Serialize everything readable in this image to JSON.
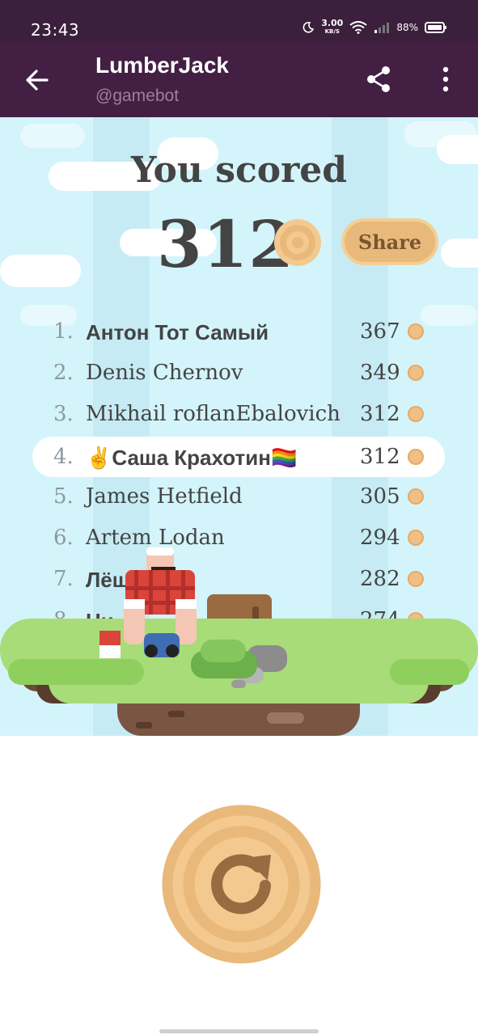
{
  "status_bar": {
    "time": "23:43",
    "speed_value": "3.00",
    "speed_unit": "KB/S",
    "battery": "88%"
  },
  "app_bar": {
    "title": "LumberJack",
    "subtitle": "@gamebot"
  },
  "game": {
    "heading": "You scored",
    "score": "312",
    "share_label": "Share",
    "leaderboard": [
      {
        "rank": "1.",
        "name": "Антон Тот Самый",
        "score": "367"
      },
      {
        "rank": "2.",
        "name": "Denis Chernov",
        "score": "349"
      },
      {
        "rank": "3.",
        "name": "Mikhail roflanEbalovich",
        "score": "312"
      },
      {
        "rank": "4.",
        "name": "✌️Саша Крахотин🏳️‍🌈",
        "score": "312"
      },
      {
        "rank": "5.",
        "name": "James Hetfield",
        "score": "305"
      },
      {
        "rank": "6.",
        "name": "Artem Lodan",
        "score": "294"
      },
      {
        "rank": "7.",
        "name": "Лёш",
        "score": "282"
      },
      {
        "rank": "8.",
        "name": "Ни",
        "score": "274"
      }
    ]
  },
  "icons": {
    "back": "arrow-left-icon",
    "share": "share-icon",
    "more": "more-vertical-icon",
    "replay": "replay-icon"
  },
  "colors": {
    "status_bar": "#3b1f3c",
    "app_bar": "#431f44",
    "sky": "#d3f4fa",
    "grass": "#a8dc78",
    "wood": "#e8b97a"
  }
}
